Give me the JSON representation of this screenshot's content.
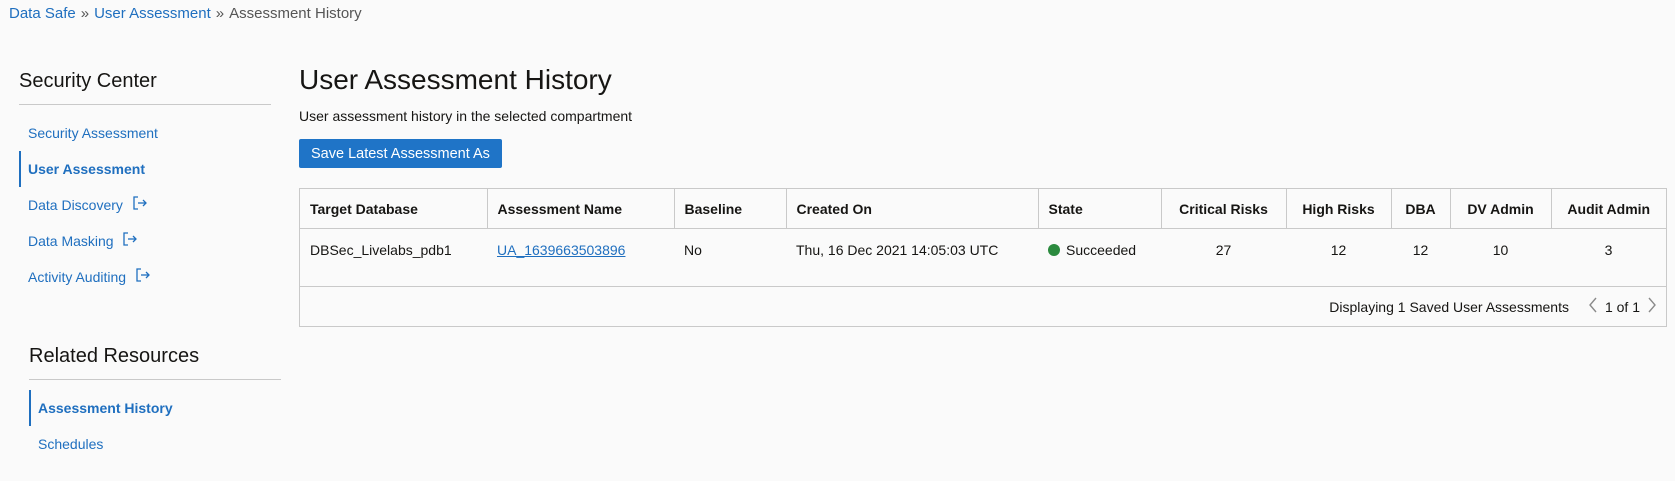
{
  "breadcrumb": {
    "items": [
      "Data Safe",
      "User Assessment",
      "Assessment History"
    ],
    "separator": "»"
  },
  "sidebar": {
    "title": "Security Center",
    "items": [
      {
        "label": "Security Assessment",
        "active": false,
        "external": false
      },
      {
        "label": "User Assessment",
        "active": true,
        "external": false
      },
      {
        "label": "Data Discovery",
        "active": false,
        "external": true
      },
      {
        "label": "Data Masking",
        "active": false,
        "external": true
      },
      {
        "label": "Activity Auditing",
        "active": false,
        "external": true
      }
    ]
  },
  "related": {
    "title": "Related Resources",
    "items": [
      {
        "label": "Assessment History",
        "active": true
      },
      {
        "label": "Schedules",
        "active": false
      }
    ]
  },
  "main": {
    "title": "User Assessment History",
    "subtitle": "User assessment history in the selected compartment",
    "save_button": "Save Latest Assessment As"
  },
  "table": {
    "headers": [
      "Target Database",
      "Assessment Name",
      "Baseline",
      "Created On",
      "State",
      "Critical Risks",
      "High Risks",
      "DBA",
      "DV Admin",
      "Audit Admin"
    ],
    "rows": [
      {
        "target": "DBSec_Livelabs_pdb1",
        "name": "UA_1639663503896",
        "baseline": "No",
        "created": "Thu, 16 Dec 2021 14:05:03 UTC",
        "state": "Succeeded",
        "critical": "27",
        "high": "12",
        "dba": "12",
        "dv_admin": "10",
        "audit_admin": "3"
      }
    ],
    "footer_text": "Displaying 1 Saved User Assessments",
    "page_text": "1 of 1"
  },
  "colors": {
    "link": "#1f6fbf",
    "primary_button": "#1f74c7",
    "state_succeeded": "#2b8a3e"
  },
  "icons": {
    "external": "external-link-icon",
    "prev": "chevron-left-icon",
    "next": "chevron-right-icon",
    "state": "status-dot-icon"
  }
}
